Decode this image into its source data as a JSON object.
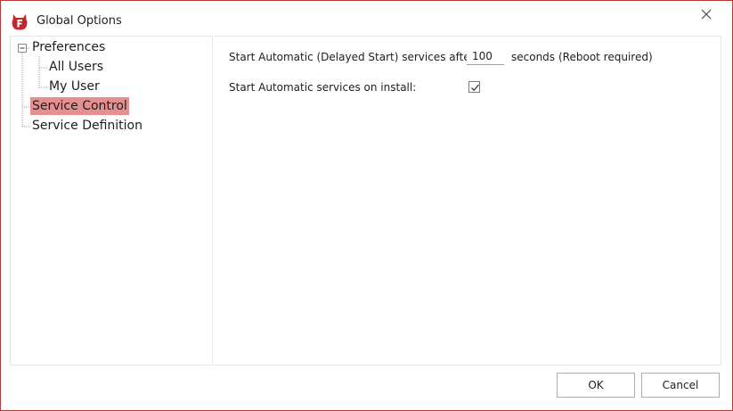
{
  "window": {
    "title": "Global Options",
    "icon": "firedaemon-logo-icon",
    "accent_color": "#b63a3a"
  },
  "tree": {
    "items": [
      {
        "label": "Preferences",
        "level": 0,
        "expanded": true
      },
      {
        "label": "All Users",
        "level": 1
      },
      {
        "label": "My User",
        "level": 1
      },
      {
        "label": "Service Control",
        "level": 0,
        "selected": true
      },
      {
        "label": "Service Definition",
        "level": 0
      }
    ],
    "selected_color": "#e58f8f"
  },
  "service_control": {
    "delayed_label": "Start Automatic (Delayed Start) services after",
    "delayed_value": "100",
    "delayed_unit": "seconds",
    "delayed_note": "(Reboot required)",
    "install_label": "Start Automatic services on install:",
    "install_checked": true
  },
  "buttons": {
    "ok": "OK",
    "cancel": "Cancel"
  }
}
